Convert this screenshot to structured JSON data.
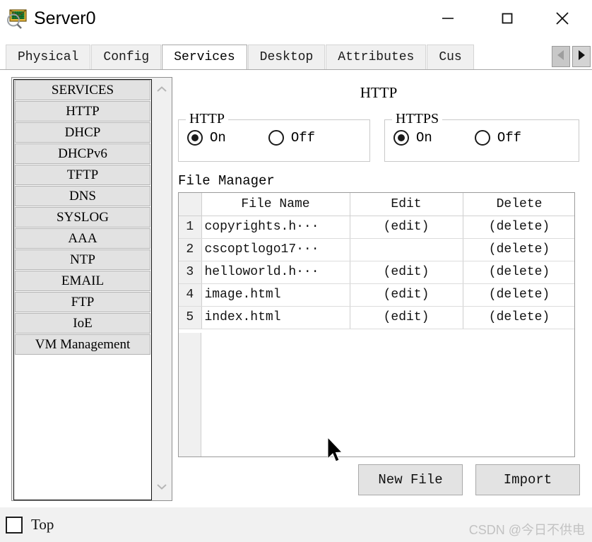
{
  "window": {
    "title": "Server0",
    "icon": "server-magnifier-icon",
    "controls": {
      "minimize": "minimize-icon",
      "maximize": "maximize-icon",
      "close": "close-icon"
    }
  },
  "tabs": {
    "items": [
      {
        "label": "Physical",
        "active": false
      },
      {
        "label": "Config",
        "active": false
      },
      {
        "label": "Services",
        "active": true
      },
      {
        "label": "Desktop",
        "active": false
      },
      {
        "label": "Attributes",
        "active": false
      },
      {
        "label": "Cus",
        "active": false
      }
    ],
    "scroll_left": "triangle-left-icon",
    "scroll_right": "triangle-right-icon"
  },
  "sidebar": {
    "items": [
      {
        "label": "SERVICES"
      },
      {
        "label": "HTTP"
      },
      {
        "label": "DHCP"
      },
      {
        "label": "DHCPv6"
      },
      {
        "label": "TFTP"
      },
      {
        "label": "DNS"
      },
      {
        "label": "SYSLOG"
      },
      {
        "label": "AAA"
      },
      {
        "label": "NTP"
      },
      {
        "label": "EMAIL"
      },
      {
        "label": "FTP"
      },
      {
        "label": "IoE"
      },
      {
        "label": "VM Management"
      }
    ],
    "scroll_up": "chevron-up-icon",
    "scroll_down": "chevron-down-icon"
  },
  "main": {
    "title": "HTTP",
    "http_group": {
      "legend": "HTTP",
      "on_label": "On",
      "off_label": "Off",
      "selected": "On"
    },
    "https_group": {
      "legend": "HTTPS",
      "on_label": "On",
      "off_label": "Off",
      "selected": "On"
    },
    "file_manager": {
      "label": "File Manager",
      "columns": [
        "",
        "File Name",
        "Edit",
        "Delete"
      ],
      "rows": [
        {
          "num": "1",
          "name": "copyrights.h···",
          "edit": "(edit)",
          "delete": "(delete)"
        },
        {
          "num": "2",
          "name": "cscoptlogo17···",
          "edit": "",
          "delete": "(delete)"
        },
        {
          "num": "3",
          "name": "helloworld.h···",
          "edit": "(edit)",
          "delete": "(delete)"
        },
        {
          "num": "4",
          "name": "image.html",
          "edit": "(edit)",
          "delete": "(delete)"
        },
        {
          "num": "5",
          "name": "index.html",
          "edit": "(edit)",
          "delete": "(delete)"
        }
      ],
      "new_file_button": "New File",
      "import_button": "Import"
    }
  },
  "footer": {
    "top_checkbox_label": "Top",
    "top_checkbox_checked": false,
    "watermark": "CSDN @今日不供电"
  },
  "colors": {
    "tab_active_bg": "#ffffff",
    "tab_inactive_bg": "#f0f0f0",
    "sidebar_item_bg": "#e2e2e2",
    "button_bg": "#e3e3e3",
    "footer_bg": "#f1f1f1",
    "watermark": "#c2c2c2"
  }
}
